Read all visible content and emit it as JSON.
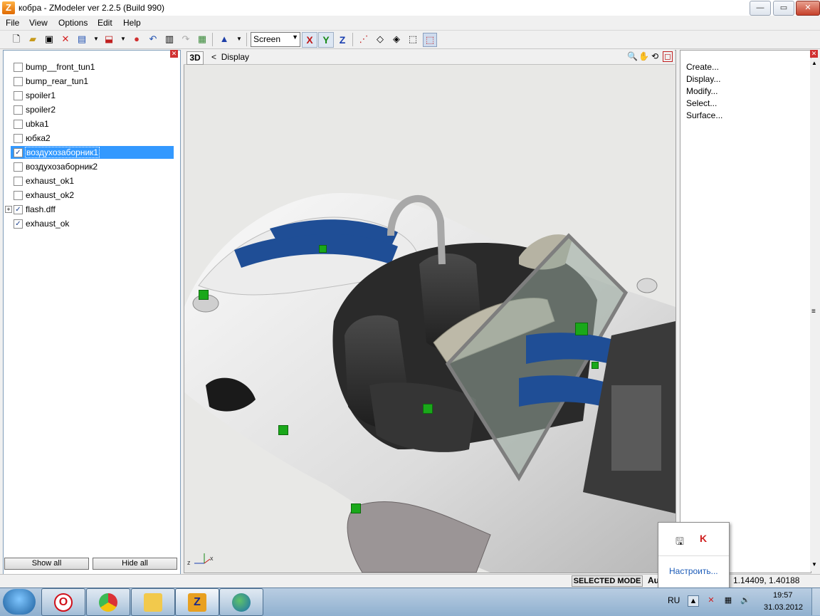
{
  "window": {
    "title": "кобра - ZModeler ver 2.2.5 (Build 990)",
    "controls": {
      "minimize": "—",
      "maximize": "▭",
      "close": "✕"
    }
  },
  "menu": [
    "File",
    "View",
    "Options",
    "Edit",
    "Help"
  ],
  "toolbar": {
    "view_select": "Screen",
    "axis_x": "X",
    "axis_y": "Y",
    "axis_z": "Z"
  },
  "object_tree": {
    "items": [
      {
        "label": "bump__front_tun1",
        "checked": false,
        "selected": false
      },
      {
        "label": "bump_rear_tun1",
        "checked": false,
        "selected": false
      },
      {
        "label": "spoiler1",
        "checked": false,
        "selected": false
      },
      {
        "label": "spoiler2",
        "checked": false,
        "selected": false
      },
      {
        "label": "ubka1",
        "checked": false,
        "selected": false
      },
      {
        "label": "юбка2",
        "checked": false,
        "selected": false
      },
      {
        "label": "воздухозаборник1",
        "checked": true,
        "selected": true
      },
      {
        "label": "воздухозаборник2",
        "checked": false,
        "selected": false
      },
      {
        "label": "exhaust_ok1",
        "checked": false,
        "selected": false
      },
      {
        "label": "exhaust_ok2",
        "checked": false,
        "selected": false
      },
      {
        "label": "flash.dff",
        "checked": true,
        "selected": false,
        "expandable": true
      },
      {
        "label": "exhaust_ok",
        "checked": true,
        "selected": false
      }
    ],
    "show_all": "Show all",
    "hide_all": "Hide all"
  },
  "viewport": {
    "mode": "3D",
    "nav_arrow": "<",
    "label": "Display",
    "axis_gizmo": {
      "z": "z",
      "x": "x"
    }
  },
  "command_panel": [
    "Create...",
    "Display...",
    "Modify...",
    "Select...",
    "Surface..."
  ],
  "status": {
    "mode": "SELECTED MODE",
    "partial": "Au",
    "coords": "1.14409, 1.40188"
  },
  "tray_popup": {
    "link": "Настроить..."
  },
  "taskbar": {
    "apps": [
      "opera-icon",
      "chrome-icon",
      "explorer-icon",
      "zmodeler-icon",
      "globe-icon"
    ],
    "lang": "RU",
    "time": "19:57",
    "date": "31.03.2012"
  },
  "colors": {
    "selection": "#3399ff",
    "car_stripe": "#1f4e96",
    "car_body": "#f2f2f2",
    "marker": "#1aa81a"
  }
}
